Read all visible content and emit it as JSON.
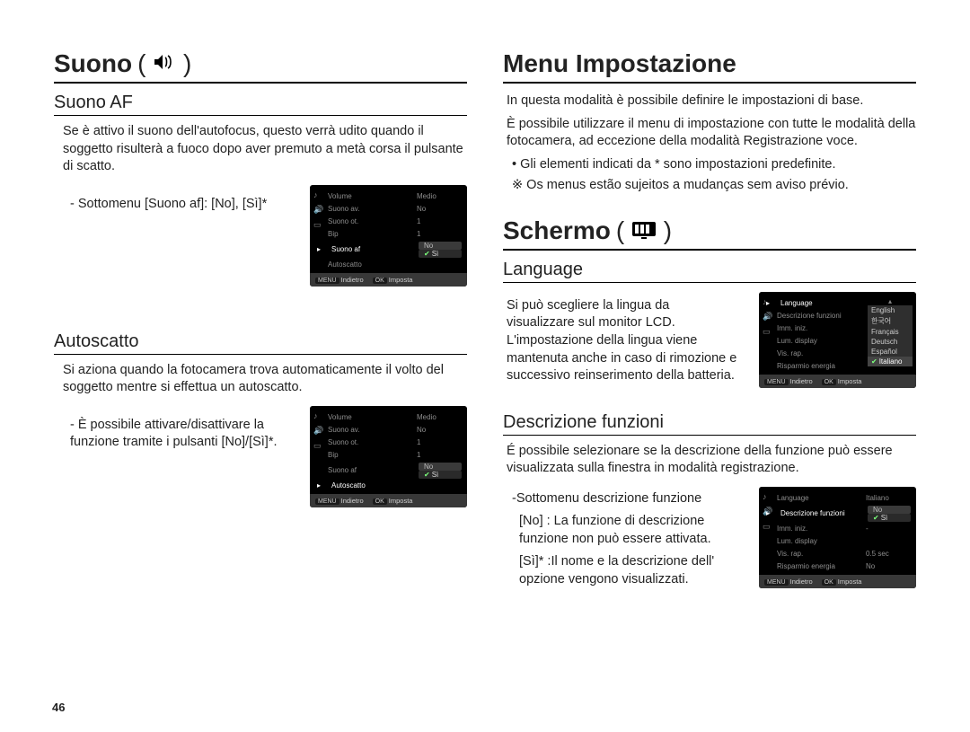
{
  "page_number": "46",
  "left": {
    "heading": "Suono",
    "heading_icon": "speaker-icon",
    "sections": [
      {
        "title": "Suono AF",
        "body": "Se è attivo il suono dell'autofocus, questo verrà udito quando il soggetto risulterà a fuoco dopo aver premuto a metà corsa il pulsante di scatto.",
        "sub": "- Sottomenu [Suono af]: [No], [Sì]*",
        "lcd": {
          "icons": [
            "♪",
            "🔊",
            "▭"
          ],
          "rows": [
            {
              "label": "Volume",
              "val": "Medio"
            },
            {
              "label": "Suono av.",
              "val": "No"
            },
            {
              "label": "Suono ot.",
              "val": "1"
            },
            {
              "label": "Bip",
              "val": "1"
            },
            {
              "label": "Suono af",
              "active": true,
              "options": [
                "No",
                "Sì"
              ],
              "selected": "Sì"
            },
            {
              "label": "Autoscatto",
              "val": ""
            }
          ],
          "footer": {
            "back_btn": "MENU",
            "back": "Indietro",
            "set_btn": "OK",
            "set": "Imposta"
          }
        }
      },
      {
        "title": "Autoscatto",
        "body": "Si aziona quando la fotocamera trova automaticamente il volto del soggetto mentre si effettua un autoscatto.",
        "sub": "- È possibile attivare/disattivare la funzione tramite i pulsanti [No]/[Sì]*.",
        "lcd": {
          "icons": [
            "♪",
            "🔊",
            "▭"
          ],
          "rows": [
            {
              "label": "Volume",
              "val": "Medio"
            },
            {
              "label": "Suono av.",
              "val": "No"
            },
            {
              "label": "Suono ot.",
              "val": "1"
            },
            {
              "label": "Bip",
              "val": "1"
            },
            {
              "label": "Suono af",
              "val": "No"
            },
            {
              "label": "Autoscatto",
              "active": true,
              "options": [
                "No",
                "Sì"
              ],
              "selected": "Sì"
            }
          ],
          "footer": {
            "back_btn": "MENU",
            "back": "Indietro",
            "set_btn": "OK",
            "set": "Imposta"
          }
        }
      }
    ]
  },
  "right": {
    "heading1": "Menu Impostazione",
    "intro": [
      "In questa modalità è possibile definire le impostazioni di base.",
      "È possibile utilizzare il menu di impostazione con tutte le modalità della fotocamera, ad eccezione della modalità Registrazione voce."
    ],
    "bullet": "Gli elementi indicati da * sono impostazioni predefinite.",
    "note": "※ Os menus estão sujeitos a mudanças sem aviso prévio.",
    "heading2": "Schermo",
    "heading2_icon": "screen-icon",
    "sections": [
      {
        "title": "Language",
        "body": "Si può scegliere la lingua da visualizzare sul monitor LCD. L'impostazione della lingua viene mantenuta anche in caso di rimozione e successivo reinserimento della batteria.",
        "lcd": {
          "icons": [
            "♪",
            "🔊",
            "▭"
          ],
          "rows": [
            {
              "label": "Language",
              "active": true
            },
            {
              "label": "Descrizione funzioni"
            },
            {
              "label": "Imm. iniz."
            },
            {
              "label": "Lum. display"
            },
            {
              "label": "Vis. rap."
            },
            {
              "label": "Risparmio energia"
            }
          ],
          "lang_options": [
            "English",
            "한국어",
            "Français",
            "Deutsch",
            "Español",
            "Italiano"
          ],
          "lang_selected": "Italiano",
          "footer": {
            "back_btn": "MENU",
            "back": "Indietro",
            "set_btn": "OK",
            "set": "Imposta"
          }
        }
      },
      {
        "title": "Descrizione funzioni",
        "body": "É possibile selezionare se la descrizione della funzione può essere visualizzata sulla finestra in modalità registrazione.",
        "sub_lines": [
          "-Sottomenu descrizione funzione",
          " [No] : La funzione di descrizione funzione non può essere attivata.",
          " [Sì]* :Il nome e la descrizione dell' opzione vengono visualizzati."
        ],
        "lcd": {
          "icons": [
            "♪",
            "🔊",
            "▭"
          ],
          "rows": [
            {
              "label": "Language",
              "val": "Italiano"
            },
            {
              "label": "Descrizione funzioni",
              "active": true,
              "options": [
                "No",
                "Sì"
              ],
              "selected": "Sì"
            },
            {
              "label": "Imm. iniz.",
              "val": "-"
            },
            {
              "label": "Lum. display",
              "val": ""
            },
            {
              "label": "Vis. rap.",
              "val": "0.5 sec"
            },
            {
              "label": "Risparmio energia",
              "val": "No"
            }
          ],
          "footer": {
            "back_btn": "MENU",
            "back": "Indietro",
            "set_btn": "OK",
            "set": "Imposta"
          }
        }
      }
    ]
  }
}
